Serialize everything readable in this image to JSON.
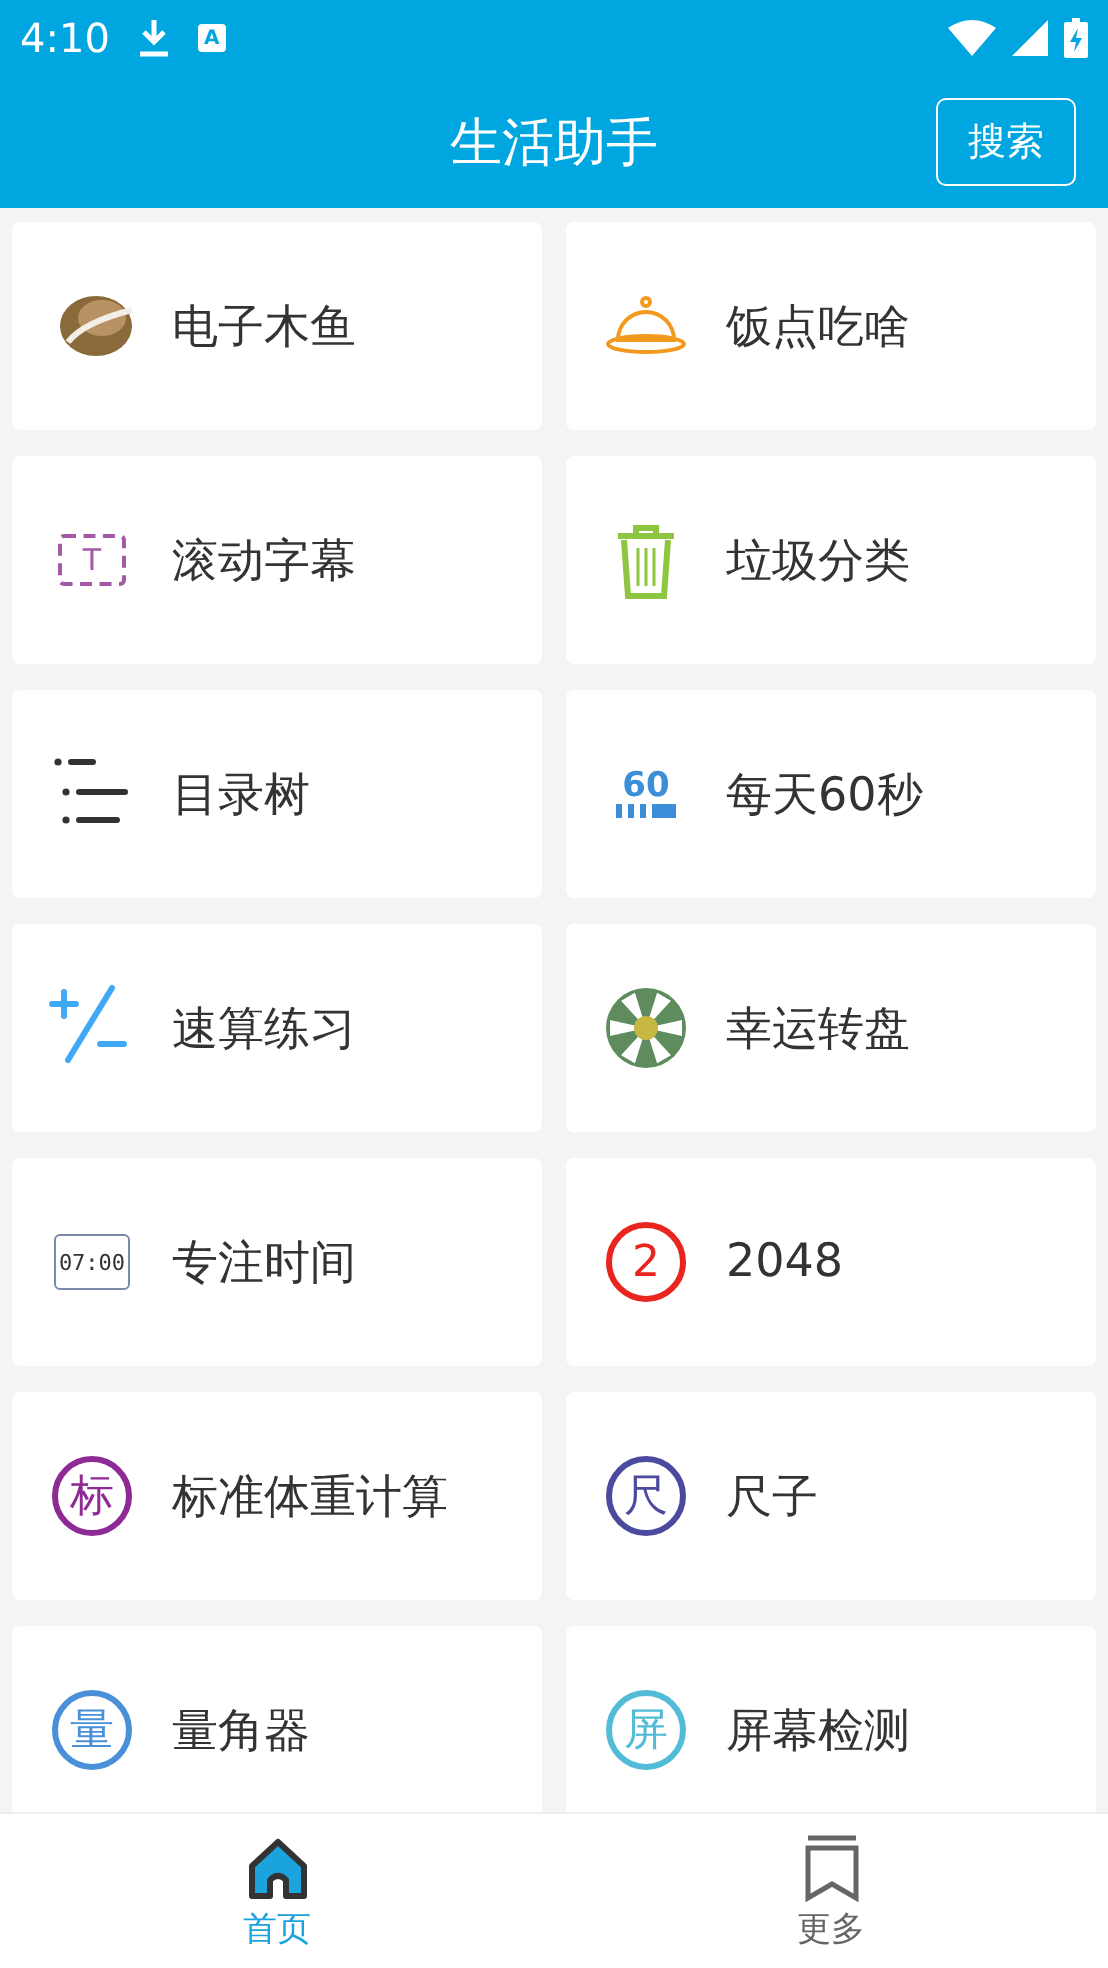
{
  "status_bar": {
    "time": "4:10",
    "notification_glyph": "A"
  },
  "app_bar": {
    "title": "生活助手",
    "action": "搜索"
  },
  "tiles": [
    {
      "kind": "fish",
      "label": "电子木鱼"
    },
    {
      "kind": "cloche",
      "label": "饭点吃啥"
    },
    {
      "kind": "marquee",
      "label": "滚动字幕",
      "glyph": "T"
    },
    {
      "kind": "trash",
      "label": "垃圾分类"
    },
    {
      "kind": "outline",
      "label": "目录树"
    },
    {
      "kind": "sixty",
      "label": "每天60秒",
      "glyph": "60"
    },
    {
      "kind": "plusminus",
      "label": "速算练习"
    },
    {
      "kind": "wheel",
      "label": "幸运转盘"
    },
    {
      "kind": "clock",
      "label": "专注时间",
      "glyph": "07:00"
    },
    {
      "kind": "badge",
      "label": "2048",
      "glyph": "2",
      "color": "#e8251f"
    },
    {
      "kind": "badge",
      "label": "标准体重计算",
      "glyph": "标",
      "color": "#8e2a94"
    },
    {
      "kind": "badge",
      "label": "尺子",
      "glyph": "尺",
      "color": "#4c4a9e"
    },
    {
      "kind": "badge",
      "label": "量角器",
      "glyph": "量",
      "color": "#4a90d9"
    },
    {
      "kind": "badge",
      "label": "屏幕检测",
      "glyph": "屏",
      "color": "#52bcd6"
    }
  ],
  "bottom_nav": [
    {
      "label": "首页",
      "kind": "home",
      "selected": true
    },
    {
      "label": "更多",
      "kind": "bookmark",
      "selected": false
    }
  ]
}
